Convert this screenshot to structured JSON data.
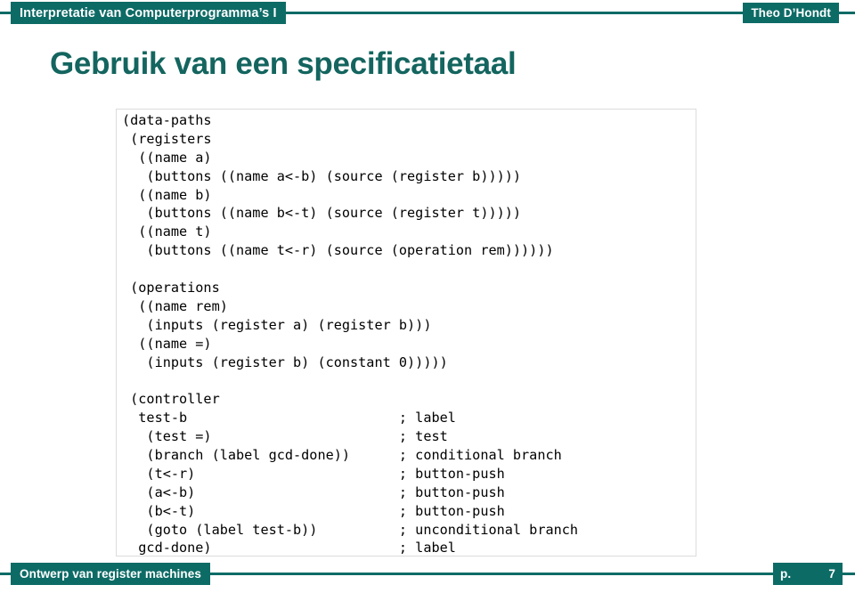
{
  "header": {
    "course": "Interpretatie van Computerprogramma’s I",
    "author": "Theo D’Hondt"
  },
  "title": "Gebruik van een specificatietaal",
  "code": {
    "lines": [
      "(data-paths",
      " (registers",
      "  ((name a)",
      "   (buttons ((name a<-b) (source (register b)))))",
      "  ((name b)",
      "   (buttons ((name b<-t) (source (register t)))))",
      "  ((name t)",
      "   (buttons ((name t<-r) (source (operation rem))))))",
      "",
      " (operations",
      "  ((name rem)",
      "   (inputs (register a) (register b)))",
      "  ((name =)",
      "   (inputs (register b) (constant 0)))))",
      "",
      " (controller",
      "  test-b                          ; label",
      "   (test =)                       ; test",
      "   (branch (label gcd-done))      ; conditional branch",
      "   (t<-r)                         ; button-push",
      "   (a<-b)                         ; button-push",
      "   (b<-t)                         ; button-push",
      "   (goto (label test-b))          ; unconditional branch",
      "  gcd-done)                       ; label"
    ]
  },
  "footer": {
    "section": "Ontwerp van register machines",
    "page_label": "p.",
    "page_number": "7"
  },
  "colors": {
    "accent": "#0d6b66",
    "title": "#14655f",
    "code_text": "#000000",
    "code_border": "#dcdcdc",
    "background": "#ffffff"
  }
}
